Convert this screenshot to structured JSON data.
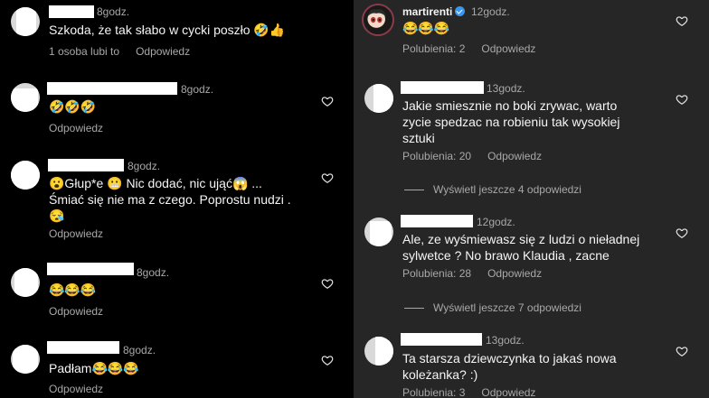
{
  "left": {
    "comments": [
      {
        "time": "8godz.",
        "text": "Szkoda, że tak słabo w cycki poszło 🤣👍",
        "likes": "1 osoba lubi to",
        "reply": "Odpowiedz"
      },
      {
        "time": "8godz.",
        "text": "🤣🤣🤣",
        "reply": "Odpowiedz"
      },
      {
        "time": "8godz.",
        "text": "😮Głup*e 😬 Nic dodać, nic ująć😱 ...\nŚmiać się  nie ma z czego. Poprostu nudzi .\n😪",
        "reply": "Odpowiedz"
      },
      {
        "time": "8godz.",
        "text": "😂😂😂",
        "reply": "Odpowiedz"
      },
      {
        "time": "8godz.",
        "text": "Padłam😂😂😂",
        "reply": "Odpowiedz"
      }
    ]
  },
  "right": {
    "comments": [
      {
        "username": "martirenti",
        "time": "12godz.",
        "text": "😂😂😂",
        "likes": "Polubienia: 2",
        "reply": "Odpowiedz"
      },
      {
        "time": "13godz.",
        "text": "Jakie smiesznie no boki zrywac, warto\nzycie spedzac na robieniu tak wysokiej\nsztuki",
        "likes": "Polubienia: 20",
        "reply": "Odpowiedz",
        "view_more": "Wyświetl jeszcze 4 odpowiedzi"
      },
      {
        "time": "12godz.",
        "text": "Ale, ze wyśmiewasz się z ludzi o nieładnej\nsylwetce ? No brawo Klaudia , zacne",
        "likes": "Polubienia: 28",
        "reply": "Odpowiedz",
        "view_more": "Wyświetl jeszcze 7 odpowiedzi"
      },
      {
        "time": "13godz.",
        "text": "Ta starsza dziewczynka to jakaś nowa\nkoleżanka? :)",
        "likes": "Polubienia: 3",
        "reply": "Odpowiedz"
      }
    ]
  },
  "colors": {
    "left_bg": "#000000",
    "right_bg": "#262626",
    "secondary_text": "#a8a8a8",
    "verified": "#3897f0"
  }
}
